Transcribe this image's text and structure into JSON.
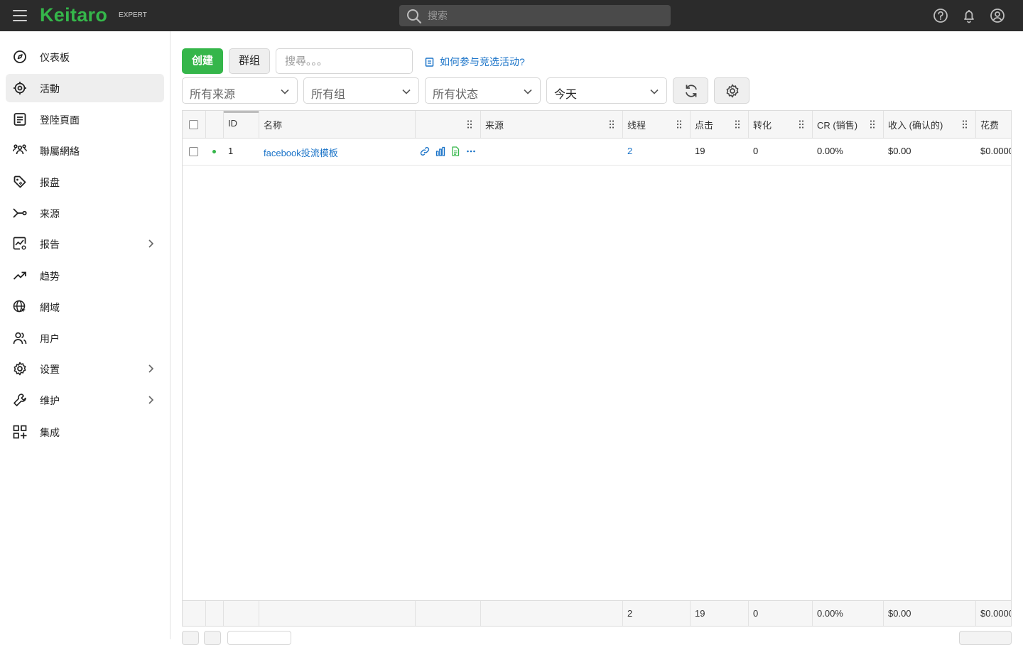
{
  "topbar": {
    "logo": "Keitaro",
    "edition": "EXPERT",
    "search_placeholder": "搜索"
  },
  "sidebar": {
    "items": [
      {
        "label": "仪表板",
        "icon": "dashboard-icon"
      },
      {
        "label": "活動",
        "icon": "campaigns-icon",
        "active": true
      },
      {
        "label": "登陸頁面",
        "icon": "landing-pages-icon"
      },
      {
        "label": "聯屬網絡",
        "icon": "affiliate-networks-icon"
      },
      {
        "label": "报盘",
        "icon": "offers-tag-icon"
      },
      {
        "label": "来源",
        "icon": "sources-icon"
      },
      {
        "label": "报告",
        "icon": "reports-icon",
        "expandable": true
      },
      {
        "label": "趋势",
        "icon": "trends-icon"
      },
      {
        "label": "網域",
        "icon": "domains-icon"
      },
      {
        "label": "用户",
        "icon": "users-icon"
      },
      {
        "label": "设置",
        "icon": "settings-icon",
        "expandable": true
      },
      {
        "label": "维护",
        "icon": "maintenance-icon",
        "expandable": true
      },
      {
        "label": "集成",
        "icon": "integrations-icon"
      }
    ]
  },
  "toolbar": {
    "create_label": "创建",
    "group_label": "群组",
    "search_placeholder": "搜尋。。。",
    "help_link": "如何参与竞选活动?"
  },
  "filters": {
    "source": "所有来源",
    "group": "所有组",
    "status": "所有状态",
    "date": "今天"
  },
  "table": {
    "columns": [
      "ID",
      "名称",
      "",
      "来源",
      "线程",
      "点击",
      "转化",
      "CR (销售)",
      "收入 (确认的)",
      "花费"
    ],
    "rows": [
      {
        "id": "1",
        "name": "facebook投流模板",
        "source": "",
        "streams": "2",
        "clicks": "19",
        "conversions": "0",
        "cr": "0.00%",
        "revenue": "$0.00",
        "cost": "$0.0000",
        "status": "active"
      }
    ],
    "totals": {
      "streams": "2",
      "clicks": "19",
      "conversions": "0",
      "cr": "0.00%",
      "revenue": "$0.00",
      "cost": "$0.0000"
    }
  },
  "colors": {
    "brand": "#35b64a",
    "link": "#1a73c8",
    "topbar": "#2b2b2b"
  }
}
